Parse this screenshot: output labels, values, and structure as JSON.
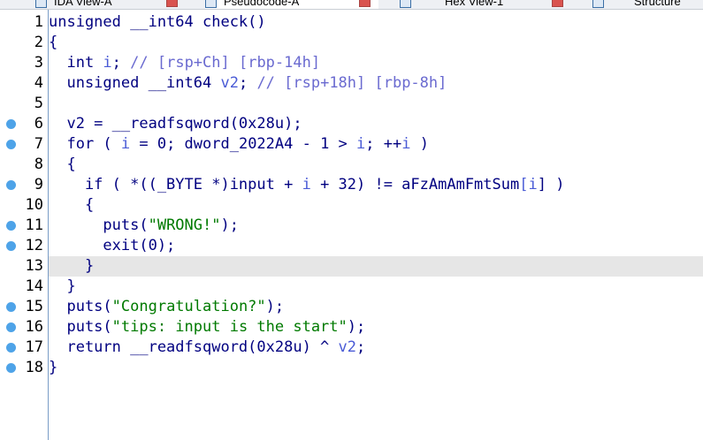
{
  "tabs": [
    {
      "label": "IDA View-A",
      "active": false,
      "closable": true
    },
    {
      "label": "Pseudocode-A",
      "active": true,
      "closable": true
    },
    {
      "label": "Hex View-1",
      "active": false,
      "closable": true
    },
    {
      "label": "Structure",
      "active": false,
      "closable": false
    }
  ],
  "colors": {
    "keyword": "#000080",
    "comment": "#6a6ad0",
    "string": "#007a00",
    "variable": "#4a5bd6",
    "breakpoint": "#4ea3e8",
    "highlight_line": "#e6e6e6"
  },
  "code": {
    "highlighted_line": "13",
    "lines": [
      {
        "no": "1",
        "bp": false,
        "text": "unsigned __int64 check()"
      },
      {
        "no": "2",
        "bp": false,
        "text": "{"
      },
      {
        "no": "3",
        "bp": false,
        "text": "  int i; // [rsp+Ch] [rbp-14h]"
      },
      {
        "no": "4",
        "bp": false,
        "text": "  unsigned __int64 v2; // [rsp+18h] [rbp-8h]"
      },
      {
        "no": "5",
        "bp": false,
        "text": ""
      },
      {
        "no": "6",
        "bp": true,
        "text": "  v2 = __readfsqword(0x28u);"
      },
      {
        "no": "7",
        "bp": true,
        "text": "  for ( i = 0; dword_2022A4 - 1 > i; ++i )"
      },
      {
        "no": "8",
        "bp": false,
        "text": "  {"
      },
      {
        "no": "9",
        "bp": true,
        "text": "    if ( *((_BYTE *)input + i + 32) != aFzAmAmFmtSum[i] )"
      },
      {
        "no": "10",
        "bp": false,
        "text": "    {"
      },
      {
        "no": "11",
        "bp": true,
        "text": "      puts(\"WRONG!\");"
      },
      {
        "no": "12",
        "bp": true,
        "text": "      exit(0);"
      },
      {
        "no": "13",
        "bp": false,
        "text": "    }"
      },
      {
        "no": "14",
        "bp": false,
        "text": "  }"
      },
      {
        "no": "15",
        "bp": true,
        "text": "  puts(\"Congratulation?\");"
      },
      {
        "no": "16",
        "bp": true,
        "text": "  puts(\"tips: input is the start\");"
      },
      {
        "no": "17",
        "bp": true,
        "text": "  return __readfsqword(0x28u) ^ v2;"
      },
      {
        "no": "18",
        "bp": true,
        "text": "}"
      }
    ]
  }
}
